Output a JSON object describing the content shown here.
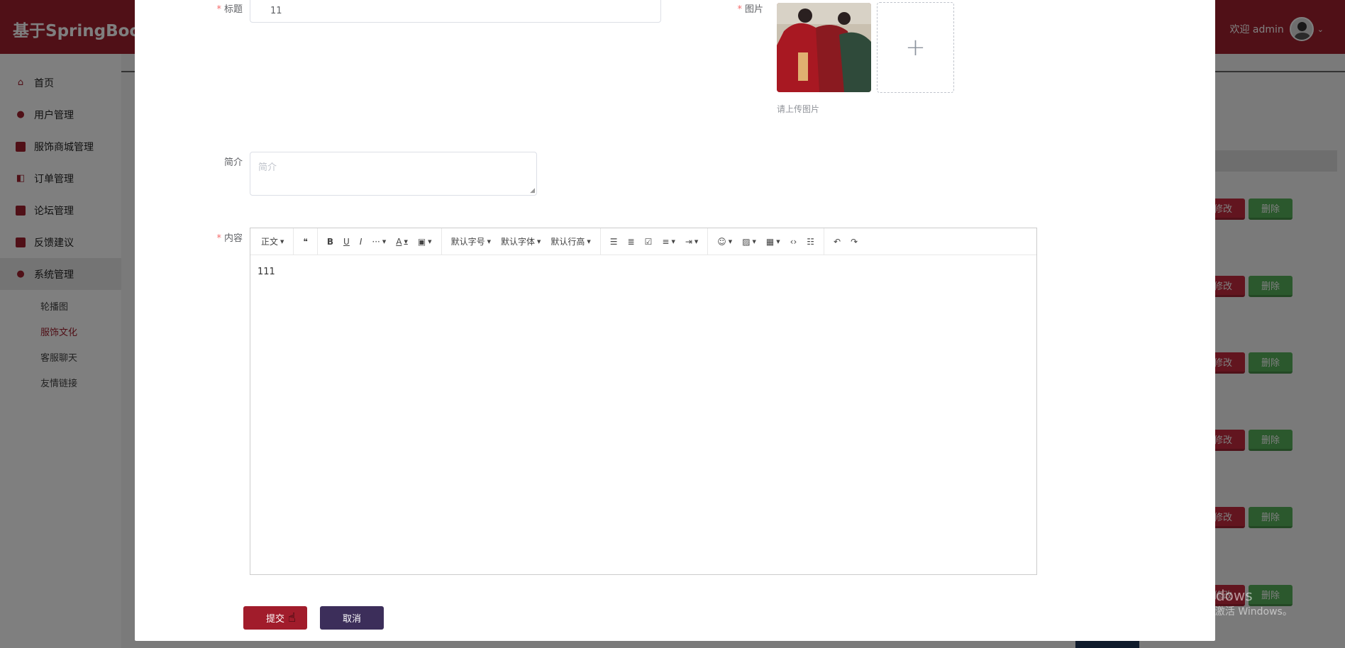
{
  "app": {
    "brand": "基于SpringBoot(",
    "welcome": "欢迎 admin"
  },
  "sidebar": {
    "items": [
      {
        "label": "首页",
        "icon": "home-icon"
      },
      {
        "label": "用户管理",
        "icon": "user-icon"
      },
      {
        "label": "服饰商城管理",
        "icon": "shop-icon"
      },
      {
        "label": "订单管理",
        "icon": "order-icon"
      },
      {
        "label": "论坛管理",
        "icon": "forum-icon"
      },
      {
        "label": "反馈建议",
        "icon": "feedback-icon"
      },
      {
        "label": "系统管理",
        "icon": "system-icon"
      }
    ],
    "subitems": [
      {
        "label": "轮播图"
      },
      {
        "label": "服饰文化"
      },
      {
        "label": "客服聊天"
      },
      {
        "label": "友情链接"
      }
    ]
  },
  "table": {
    "edit_label": "修改",
    "delete_label": "删除"
  },
  "form": {
    "title_label": "标题",
    "title_value": "11",
    "image_label": "图片",
    "image_tip": "请上传图片",
    "summary_label": "简介",
    "summary_placeholder": "简介",
    "content_label": "内容",
    "content_value": "111",
    "submit_label": "提交",
    "cancel_label": "取消"
  },
  "editor": {
    "toolbar": {
      "paragraph": "正文",
      "font_size": "默认字号",
      "font_family": "默认字体",
      "line_height": "默认行高",
      "more": "···",
      "font_color": "A"
    }
  },
  "watermark": {
    "line1": "激活 Windows",
    "line2": "转到\"设置\"以激活 Windows。"
  },
  "colors": {
    "primary": "#a0202e",
    "edit": "#c42b3e",
    "delete": "#57b05a",
    "cancel": "#3c2e5a"
  }
}
